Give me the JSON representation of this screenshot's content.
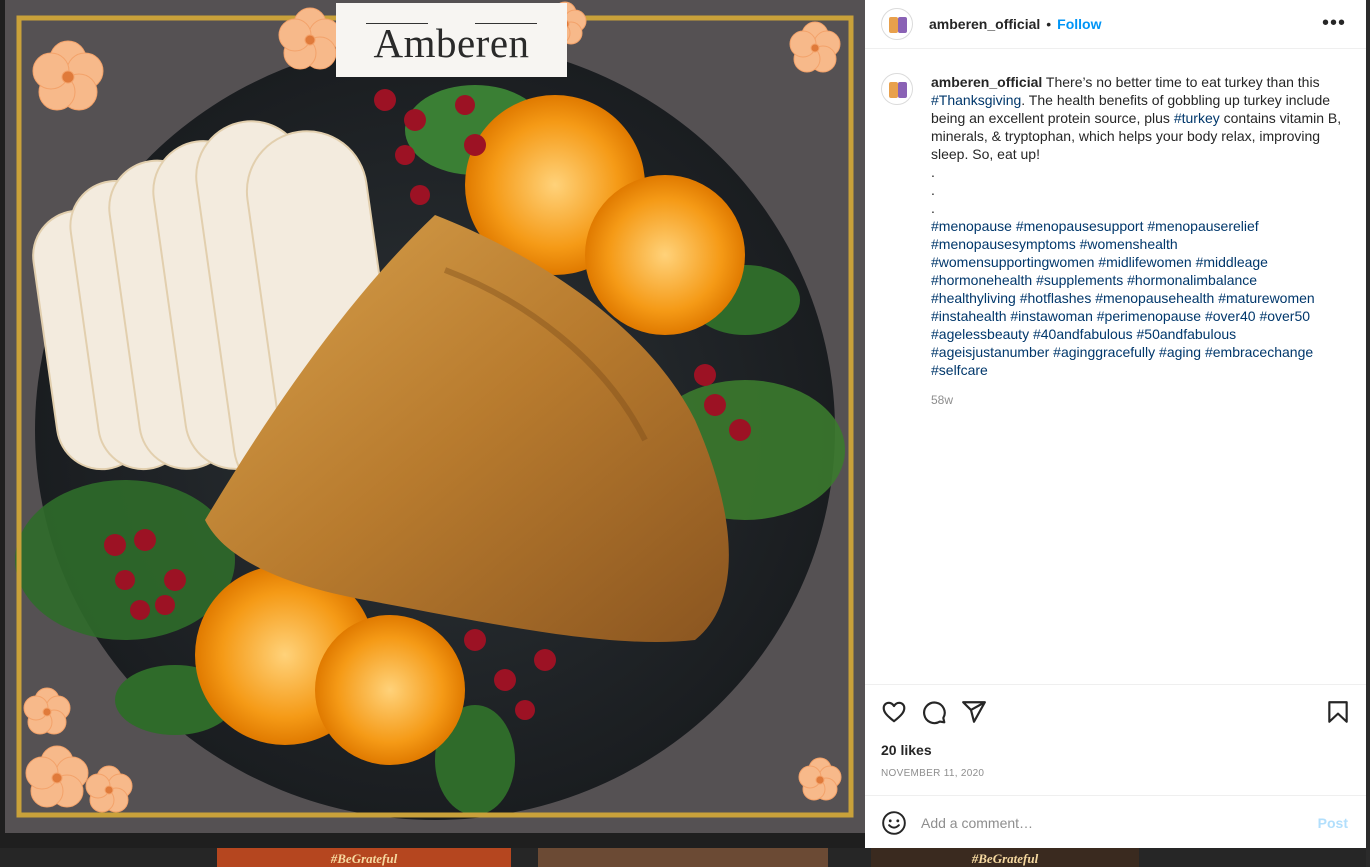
{
  "brand": {
    "logo_text": "Amberen"
  },
  "post": {
    "username": "amberen_official",
    "follow_label": "Follow",
    "more_label": "•••",
    "caption": {
      "username": "amberen_official",
      "text_1": " There’s no better time to eat turkey than this ",
      "tag_thanksgiving": "#Thanksgiving",
      "text_2": ". The health benefits of gobbling up turkey include being an excellent protein source, plus ",
      "tag_turkey": "#turkey",
      "text_3": " contains vitamin B, minerals, & tryptophan, which helps your body relax, improving sleep. So, eat up!",
      "dots": [
        ".",
        ".",
        "."
      ],
      "hashtag_lines": [
        "#menopause #menopausesupport #menopauserelief",
        "#menopausesymptoms #womenshealth",
        "#womensupportingwomen #midlifewomen #middleage",
        "#hormonehealth #supplements #hormonalimbalance",
        "#healthyliving #hotflashes #menopausehealth #maturewomen",
        "#instahealth #instawoman #perimenopause #over40 #over50",
        "#agelessbeauty #40andfabulous #50andfabulous",
        "#ageisjustanumber #aginggracefully #aging #embracechange",
        "#selfcare"
      ],
      "time_ago": "58w"
    },
    "likes": "20 likes",
    "date": "NOVEMBER 11, 2020",
    "comment_placeholder": "Add a comment…",
    "post_label": "Post",
    "icons": {
      "like": "heart-icon",
      "comment": "comment-icon",
      "share": "share-icon",
      "save": "bookmark-icon",
      "emoji": "emoji-icon"
    }
  },
  "background": {
    "thumb_1": "#BeGrateful",
    "thumb_3": "#BeGrateful"
  },
  "colors": {
    "follow": "#0095f6",
    "hashtag": "#00376b",
    "muted": "#8e8e8e",
    "post_disabled": "#b2dffc",
    "frame_gold": "#c9a13a"
  }
}
